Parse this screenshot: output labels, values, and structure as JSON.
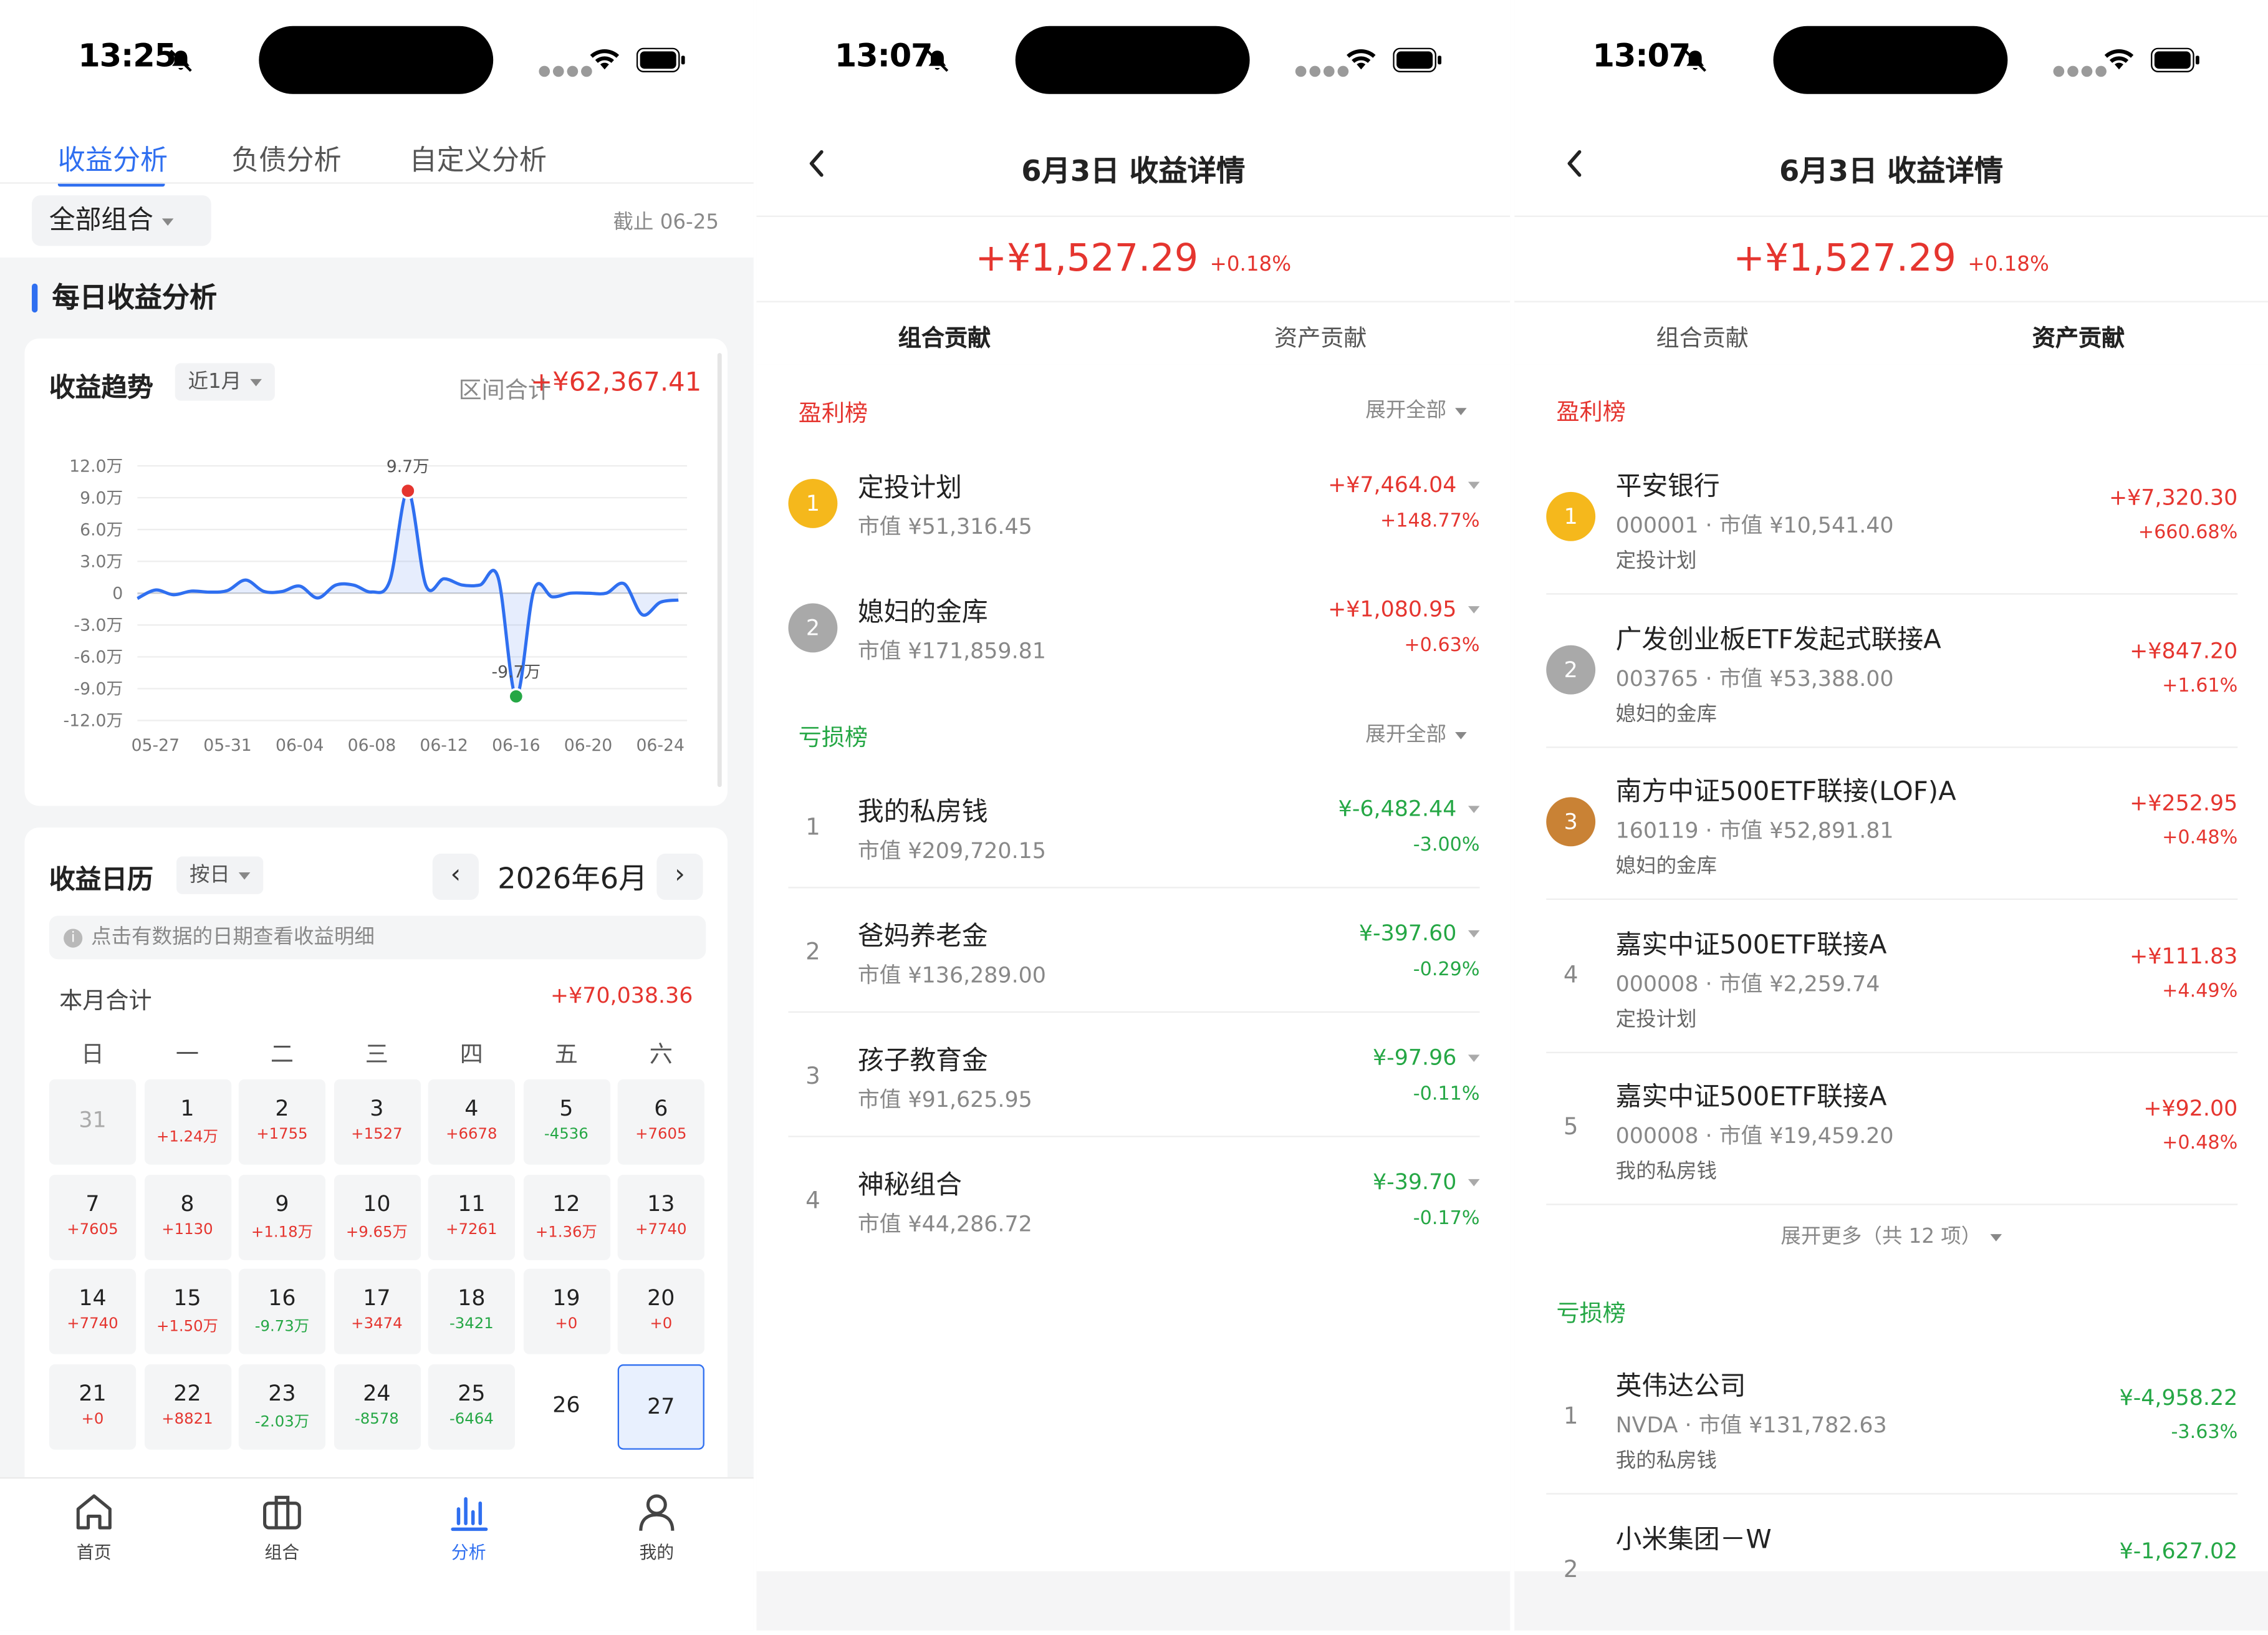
{
  "status_bars": [
    {
      "time": "13:25"
    },
    {
      "time": "13:07"
    },
    {
      "time": "13:07"
    }
  ],
  "analysis": {
    "tabs": [
      {
        "label": "收益分析",
        "active": true
      },
      {
        "label": "负债分析",
        "active": false
      },
      {
        "label": "自定义分析",
        "active": false
      }
    ],
    "portfolio_selector": "全部组合",
    "as_of": "截止 06-25",
    "section_title": "每日收益分析",
    "trend": {
      "title": "收益趋势",
      "period": "近1月",
      "range_label": "区间合计",
      "range_total": "+¥62,367.41"
    },
    "calendar": {
      "title": "收益日历",
      "mode": "按日",
      "month": "2026年6月",
      "hint": "点击有数据的日期查看收益明细",
      "total_label": "本月合计",
      "total_value": "+¥70,038.36",
      "weekdays": [
        "日",
        "一",
        "二",
        "三",
        "四",
        "五",
        "六"
      ],
      "days": [
        {
          "day": "31",
          "value": "",
          "tone": "none",
          "muted": true
        },
        {
          "day": "1",
          "value": "+1.24万",
          "tone": "red"
        },
        {
          "day": "2",
          "value": "+1755",
          "tone": "red"
        },
        {
          "day": "3",
          "value": "+1527",
          "tone": "red"
        },
        {
          "day": "4",
          "value": "+6678",
          "tone": "red"
        },
        {
          "day": "5",
          "value": "-4536",
          "tone": "green"
        },
        {
          "day": "6",
          "value": "+7605",
          "tone": "red"
        },
        {
          "day": "7",
          "value": "+7605",
          "tone": "red"
        },
        {
          "day": "8",
          "value": "+1130",
          "tone": "red"
        },
        {
          "day": "9",
          "value": "+1.18万",
          "tone": "red"
        },
        {
          "day": "10",
          "value": "+9.65万",
          "tone": "red"
        },
        {
          "day": "11",
          "value": "+7261",
          "tone": "red"
        },
        {
          "day": "12",
          "value": "+1.36万",
          "tone": "red"
        },
        {
          "day": "13",
          "value": "+7740",
          "tone": "red"
        },
        {
          "day": "14",
          "value": "+7740",
          "tone": "red"
        },
        {
          "day": "15",
          "value": "+1.50万",
          "tone": "red"
        },
        {
          "day": "16",
          "value": "-9.73万",
          "tone": "green"
        },
        {
          "day": "17",
          "value": "+3474",
          "tone": "red"
        },
        {
          "day": "18",
          "value": "-3421",
          "tone": "green"
        },
        {
          "day": "19",
          "value": "+0",
          "tone": "red"
        },
        {
          "day": "20",
          "value": "+0",
          "tone": "red"
        },
        {
          "day": "21",
          "value": "+0",
          "tone": "red"
        },
        {
          "day": "22",
          "value": "+8821",
          "tone": "red"
        },
        {
          "day": "23",
          "value": "-2.03万",
          "tone": "green"
        },
        {
          "day": "24",
          "value": "-8578",
          "tone": "green"
        },
        {
          "day": "25",
          "value": "-6464",
          "tone": "green"
        },
        {
          "day": "26",
          "value": "",
          "tone": "none",
          "blank": true
        },
        {
          "day": "27",
          "value": "",
          "tone": "none",
          "selected": true
        }
      ]
    },
    "bottom_nav": [
      {
        "label": "首页",
        "icon": "home-icon",
        "active": false
      },
      {
        "label": "组合",
        "icon": "briefcase-icon",
        "active": false
      },
      {
        "label": "分析",
        "icon": "chart-icon",
        "active": true
      },
      {
        "label": "我的",
        "icon": "user-icon",
        "active": false
      }
    ]
  },
  "chart_data": {
    "type": "line",
    "title": "",
    "xlabel": "",
    "ylabel": "",
    "y_tick_labels": [
      "12.0万",
      "9.0万",
      "6.0万",
      "3.0万",
      "0",
      "-3.0万",
      "-6.0万",
      "-9.0万",
      "-12.0万"
    ],
    "y_ticks": [
      120000,
      90000,
      60000,
      30000,
      0,
      -30000,
      -60000,
      -90000,
      -120000
    ],
    "ylim": [
      -120000,
      120000
    ],
    "x_tick_labels": [
      "05-27",
      "05-31",
      "06-04",
      "06-08",
      "06-12",
      "06-16",
      "06-20",
      "06-24"
    ],
    "categories": [
      "05-26",
      "05-27",
      "05-28",
      "05-29",
      "05-30",
      "05-31",
      "06-01",
      "06-02",
      "06-03",
      "06-04",
      "06-05",
      "06-06",
      "06-07",
      "06-08",
      "06-09",
      "06-10",
      "06-11",
      "06-12",
      "06-13",
      "06-14",
      "06-15",
      "06-16",
      "06-17",
      "06-18",
      "06-19",
      "06-20",
      "06-21",
      "06-22",
      "06-23",
      "06-24",
      "06-25"
    ],
    "values": [
      -5000,
      3000,
      -1500,
      2000,
      1000,
      2500,
      12400,
      1755,
      1527,
      6678,
      -4536,
      7605,
      7605,
      1130,
      11800,
      96500,
      7261,
      13600,
      7740,
      7740,
      15000,
      -97300,
      3474,
      -3421,
      0,
      0,
      0,
      8821,
      -20300,
      -8578,
      -6464
    ],
    "annotations": [
      {
        "label": "9.7万",
        "category": "06-10",
        "value": 96500,
        "tone": "red"
      },
      {
        "label": "-9.7万",
        "category": "06-16",
        "value": -97300,
        "tone": "green"
      }
    ],
    "color": "#2f6ff0",
    "grid": true
  },
  "detail_common": {
    "title": "6月3日 收益详情",
    "amount": "+¥1,527.29",
    "pct": "+0.18%",
    "tabs": [
      "组合贡献",
      "资产贡献"
    ]
  },
  "portfolio_detail": {
    "active_tab": 0,
    "profit": {
      "title": "盈利榜",
      "expand": "展开全部",
      "items": [
        {
          "rank": "1",
          "name": "定投计划",
          "sub": "市值 ¥51,316.45",
          "amount": "+¥7,464.04",
          "pct": "+148.77%"
        },
        {
          "rank": "2",
          "name": "媳妇的金库",
          "sub": "市值 ¥171,859.81",
          "amount": "+¥1,080.95",
          "pct": "+0.63%"
        }
      ]
    },
    "loss": {
      "title": "亏损榜",
      "expand": "展开全部",
      "items": [
        {
          "rank": "1",
          "name": "我的私房钱",
          "sub": "市值 ¥209,720.15",
          "amount": "¥-6,482.44",
          "pct": "-3.00%"
        },
        {
          "rank": "2",
          "name": "爸妈养老金",
          "sub": "市值 ¥136,289.00",
          "amount": "¥-397.60",
          "pct": "-0.29%"
        },
        {
          "rank": "3",
          "name": "孩子教育金",
          "sub": "市值 ¥91,625.95",
          "amount": "¥-97.96",
          "pct": "-0.11%"
        },
        {
          "rank": "4",
          "name": "神秘组合",
          "sub": "市值 ¥44,286.72",
          "amount": "¥-39.70",
          "pct": "-0.17%"
        }
      ]
    }
  },
  "asset_detail": {
    "active_tab": 1,
    "profit": {
      "title": "盈利榜",
      "items": [
        {
          "rank": "1",
          "name": "平安银行",
          "sub": "000001 · 市值 ¥10,541.40",
          "portfolio": "定投计划",
          "amount": "+¥7,320.30",
          "pct": "+660.68%"
        },
        {
          "rank": "2",
          "name": "广发创业板ETF发起式联接A",
          "sub": "003765 · 市值 ¥53,388.00",
          "portfolio": "媳妇的金库",
          "amount": "+¥847.20",
          "pct": "+1.61%"
        },
        {
          "rank": "3",
          "name": "南方中证500ETF联接(LOF)A",
          "sub": "160119 · 市值 ¥52,891.81",
          "portfolio": "媳妇的金库",
          "amount": "+¥252.95",
          "pct": "+0.48%"
        },
        {
          "rank": "4",
          "name": "嘉实中证500ETF联接A",
          "sub": "000008 · 市值 ¥2,259.74",
          "portfolio": "定投计划",
          "amount": "+¥111.83",
          "pct": "+4.49%"
        },
        {
          "rank": "5",
          "name": "嘉实中证500ETF联接A",
          "sub": "000008 · 市值 ¥19,459.20",
          "portfolio": "我的私房钱",
          "amount": "+¥92.00",
          "pct": "+0.48%"
        }
      ],
      "more": "展开更多（共 12 项）"
    },
    "loss": {
      "title": "亏损榜",
      "items": [
        {
          "rank": "1",
          "name": "英伟达公司",
          "sub": "NVDA · 市值 ¥131,782.63",
          "portfolio": "我的私房钱",
          "amount": "¥-4,958.22",
          "pct": "-3.63%"
        },
        {
          "rank": "2",
          "name": "小米集团－W",
          "sub": "",
          "portfolio": "",
          "amount": "¥-1,627.02",
          "pct": ""
        }
      ]
    }
  },
  "colors": {
    "accent": "#2f6ff0",
    "up": "#e5352f",
    "down": "#25a745",
    "gold": "#f5b81c",
    "silver": "#a9a9a9",
    "bronze": "#c98235"
  }
}
